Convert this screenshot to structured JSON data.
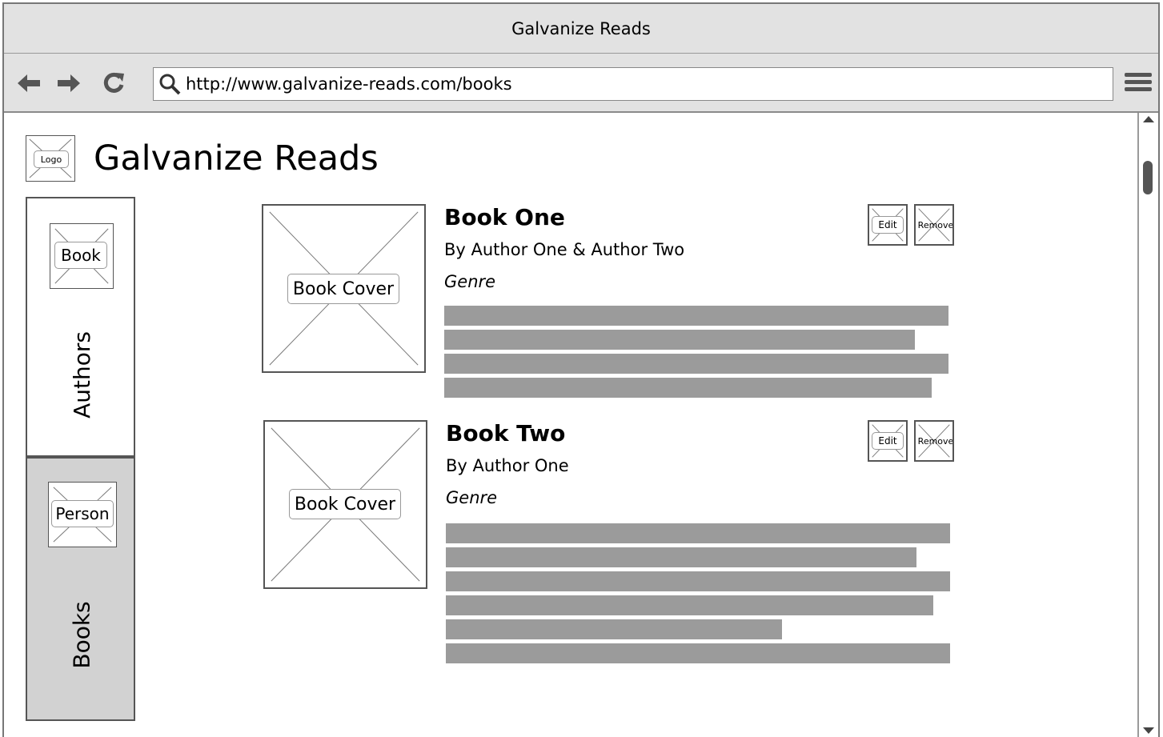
{
  "window": {
    "title": "Galvanize Reads"
  },
  "browser": {
    "url": "http://www.galvanize-reads.com/books",
    "icons": [
      "back-arrow-icon",
      "forward-arrow-icon",
      "reload-icon",
      "search-icon",
      "hamburger-menu-icon"
    ]
  },
  "header": {
    "logo_label": "Logo",
    "site_title": "Galvanize Reads"
  },
  "side_tabs": [
    {
      "label": "Authors",
      "image_label": "Book",
      "selected": true
    },
    {
      "label": "Books",
      "image_label": "Person",
      "selected": false
    }
  ],
  "books": [
    {
      "title": "Book One",
      "authors": "By Author One & Author Two",
      "genre": "Genre",
      "cover_label": "Book Cover",
      "edit_label": "Edit",
      "remove_label": "Remove",
      "description_lines": [
        1,
        0.934,
        1,
        0.967
      ]
    },
    {
      "title": "Book Two",
      "authors": "By Author One",
      "genre": "Genre",
      "cover_label": "Book Cover",
      "edit_label": "Edit",
      "remove_label": "Remove",
      "description_lines": [
        1,
        0.934,
        1,
        0.967,
        0.666,
        1
      ]
    }
  ],
  "colors": {
    "chrome_background": "#e2e2e2",
    "placeholder_text_bar": "#9b9b9b",
    "inactive_tab": "#d2d2d2",
    "border": "#555555"
  }
}
